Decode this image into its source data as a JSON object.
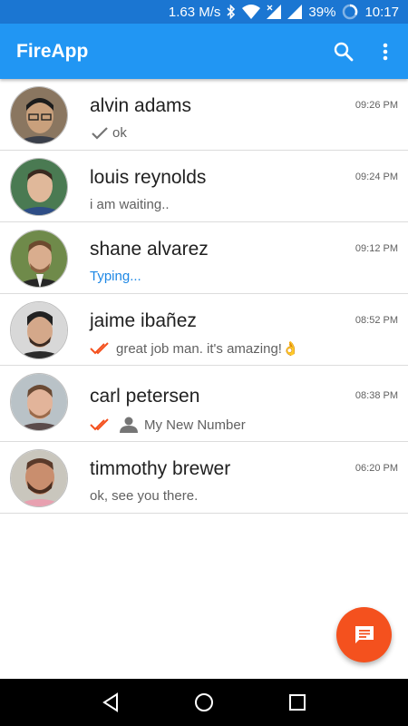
{
  "status_bar": {
    "speed": "1.63 M/s",
    "battery": "39%",
    "time": "10:17",
    "icons": [
      "bluetooth-icon",
      "wifi-icon",
      "signal-icon",
      "signal-icon",
      "battery-icon"
    ]
  },
  "app_bar": {
    "title": "FireApp",
    "actions": [
      "search-icon",
      "more-vert-icon"
    ]
  },
  "chats": [
    {
      "name": "alvin adams",
      "time": "09:26 PM",
      "message": "ok",
      "status_icon": "single-check-icon"
    },
    {
      "name": "louis reynolds",
      "time": "09:24 PM",
      "message": "i am waiting..",
      "status_icon": ""
    },
    {
      "name": "shane alvarez",
      "time": "09:12 PM",
      "message": "Typing...",
      "status_icon": ""
    },
    {
      "name": "jaime ibañez",
      "time": "08:52 PM",
      "message": "great job man. it's amazing!👌",
      "status_icon": "double-check-icon"
    },
    {
      "name": "carl petersen",
      "time": "08:38 PM",
      "message": "My New Number",
      "status_icon": "double-check-icon"
    },
    {
      "name": "timmothy brewer",
      "time": "06:20 PM",
      "message": "ok, see you there.",
      "status_icon": ""
    }
  ],
  "fab": {
    "icon": "message-icon"
  },
  "nav_bar": {
    "buttons": [
      "back-icon",
      "home-icon",
      "recents-icon"
    ]
  },
  "colors": {
    "status_bar": "#1b76d2",
    "app_bar": "#2196f3",
    "fab": "#f4511e",
    "typing": "#1e88e5",
    "read_check": "#f4511e"
  }
}
